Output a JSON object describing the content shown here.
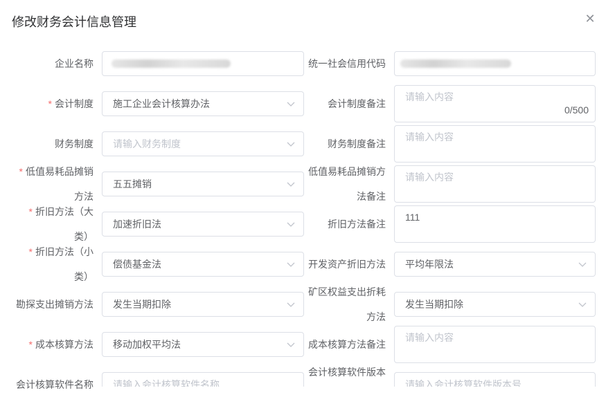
{
  "dialog": {
    "title": "修改财务会计信息管理",
    "close_icon": "close-icon"
  },
  "fields": {
    "company_name": {
      "label": "企业名称",
      "value": ""
    },
    "credit_code": {
      "label": "统一社会信用代码",
      "value": ""
    },
    "accounting_system": {
      "label": "会计制度",
      "required": "*",
      "value": "施工企业会计核算办法"
    },
    "accounting_system_note": {
      "label": "会计制度备注",
      "placeholder": "请输入内容",
      "counter": "0/500"
    },
    "financial_system": {
      "label": "财务制度",
      "placeholder": "请输入财务制度"
    },
    "financial_system_note": {
      "label": "财务制度备注",
      "placeholder": "请输入内容"
    },
    "low_value_amortization": {
      "label_1": "低值易耗品摊销",
      "label_2": "方法",
      "required": "*",
      "value": "五五摊销"
    },
    "low_value_amortization_note": {
      "label_1": "低值易耗品摊销方",
      "label_2": "法备注",
      "placeholder": "请输入内容"
    },
    "depreciation_major": {
      "label_1": "折旧方法（大",
      "label_2": "类）",
      "required": "*",
      "value": "加速折旧法"
    },
    "depreciation_note": {
      "label": "折旧方法备注",
      "value": "111"
    },
    "depreciation_minor": {
      "label_1": "折旧方法（小",
      "label_2": "类）",
      "required": "*",
      "value": "偿债基金法"
    },
    "dev_asset_depreciation": {
      "label": "开发资产折旧方法",
      "value": "平均年限法"
    },
    "exploration_amortization": {
      "label": "勘探支出摊销方法",
      "value": "发生当期扣除"
    },
    "mining_rights_depletion": {
      "label_1": "矿区权益支出折耗",
      "label_2": "方法",
      "value": "发生当期扣除"
    },
    "cost_accounting": {
      "label": "成本核算方法",
      "required": "*",
      "value": "移动加权平均法"
    },
    "cost_accounting_note": {
      "label": "成本核算方法备注",
      "placeholder": "请输入内容"
    },
    "software_name": {
      "label": "会计核算软件名称",
      "placeholder": "请输入会计核算软件名称"
    },
    "software_version": {
      "label": "会计核算软件版本",
      "placeholder": "请输入会计核算软件版本号"
    }
  },
  "icons": {
    "dropdown": "chevron-down-icon"
  },
  "colors": {
    "required": "#f56c6c",
    "border": "#dcdfe6",
    "placeholder": "#c0c4cc",
    "text": "#606266",
    "title": "#303133"
  }
}
